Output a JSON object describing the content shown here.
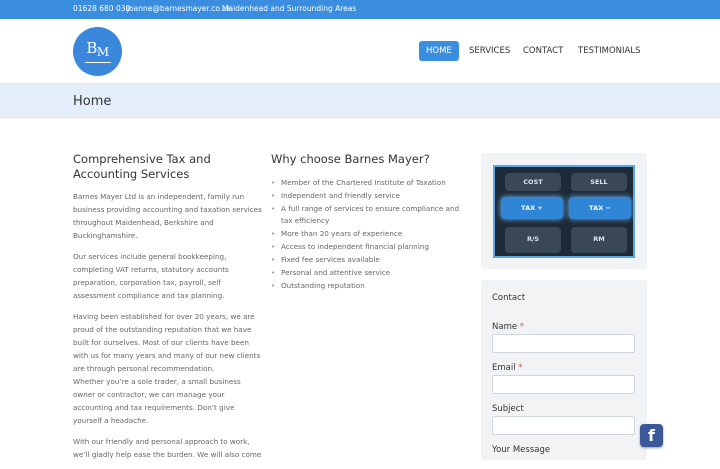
{
  "topbar": {
    "phone": "01628 680 030",
    "email": "joanne@barnesmayer.co.uk",
    "area": "Maidenhead and Surrounding Areas"
  },
  "logo": {
    "text_b": "B",
    "text_m": "M"
  },
  "nav": {
    "items": [
      {
        "label": "HOME",
        "active": true
      },
      {
        "label": "SERVICES",
        "active": false
      },
      {
        "label": "CONTACT",
        "active": false
      },
      {
        "label": "TESTIMONIALS",
        "active": false
      }
    ]
  },
  "page": {
    "title": "Home"
  },
  "intro": {
    "heading": "Comprehensive Tax and Accounting Services",
    "paragraphs": [
      "Barnes Mayer Ltd is an independent, family run business providing accounting and taxation services throughout Maidenhead, Berkshire and Buckinghamshire.",
      "Our services include general bookkeeping, completing VAT returns, statutory accounts preparation, corporation tax, payroll, self assessment compliance and tax planning.",
      "Having been established for over 20 years, we are proud of the outstanding reputation that we have built for ourselves. Most of our clients have been with us for many years and many of our new clients are through personal recommendation.",
      "Whether you’re a sole trader, a small business owner or contractor, we can manage your accounting and tax requirements. Don’t give yourself a headache.",
      "With our friendly and personal approach to work, we’ll gladly help ease the burden. We will also come"
    ]
  },
  "why": {
    "heading": "Why choose Barnes Mayer?",
    "items": [
      "Member of the Chartered Institute of Taxation",
      "Independent and friendly service",
      "A full range of services to ensure compliance and tax efficiency",
      "More than 20 years of experience",
      "Access to independent financial planning",
      "Fixed fee services available",
      "Personal and attentive service",
      "Outstanding reputation"
    ]
  },
  "calculator": {
    "keys": [
      "COST",
      "SELL",
      "TAX +",
      "TAX −",
      "R/S",
      "RM"
    ]
  },
  "contact_form": {
    "title": "Contact",
    "name_label": "Name",
    "email_label": "Email",
    "subject_label": "Subject",
    "message_label": "Your Message",
    "required_mark": "*"
  },
  "social": {
    "facebook_glyph": "f"
  },
  "colors": {
    "accent": "#3b8de0",
    "title_bar": "#e3eefa",
    "widget_bg": "#f2f3f5",
    "required": "#d9534f",
    "facebook": "#3b5998"
  }
}
